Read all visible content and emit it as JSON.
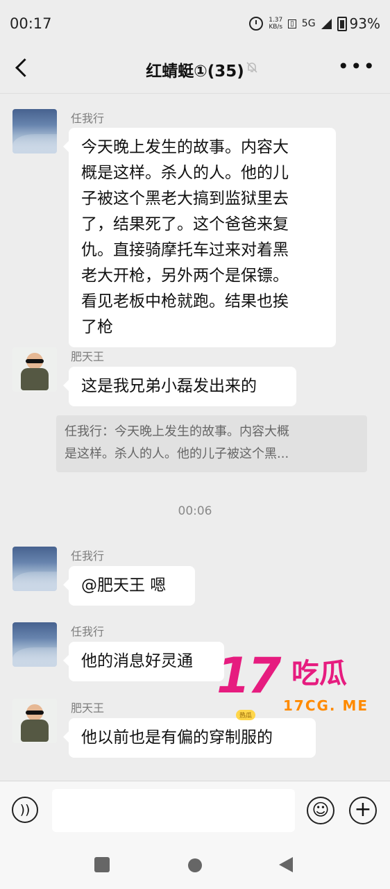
{
  "status_bar": {
    "time": "00:17",
    "net_speed_value": "1.37",
    "net_speed_unit": "KB/s",
    "signal_type": "5G",
    "battery": "93%"
  },
  "header": {
    "title": "红蜻蜓①(35)",
    "icons": [
      "back-icon",
      "mute-bell-icon",
      "more-icon"
    ]
  },
  "messages": [
    {
      "sender": "任我行",
      "lines": [
        "今天晚上发生的故事。内容大",
        "概是这样。杀人的人。他的儿",
        "子被这个黑老大搞到监狱里去",
        "了，结果死了。这个爸爸来复",
        "仇。直接骑摩托车过来对着黑",
        "老大开枪，另外两个是保镖。",
        "看见老板中枪就跑。结果也挨",
        "了枪"
      ]
    },
    {
      "sender": "肥天王",
      "text": "这是我兄弟小磊发出来的",
      "quote": [
        "任我行：今天晚上发生的故事。内容大概",
        "是这样。杀人的人。他的儿子被这个黑..."
      ]
    },
    {
      "sender": "任我行",
      "text": "@肥天王  嗯"
    },
    {
      "sender": "任我行",
      "text": "他的消息好灵通"
    },
    {
      "sender": "肥天王",
      "text": "他以前也是有偏的穿制服的"
    }
  ],
  "divider_time": "00:06",
  "watermark": {
    "number": "17",
    "brand": "吃瓜",
    "url": "17CG. ME",
    "badge": "热瓜"
  },
  "composer": {
    "icons": [
      "voice-icon",
      "emoji-icon",
      "plus-icon"
    ]
  },
  "colors": {
    "background": "#ededed",
    "bubble": "#ffffff",
    "sender_name": "#7d7d7d",
    "watermark": "#e61c7f"
  }
}
